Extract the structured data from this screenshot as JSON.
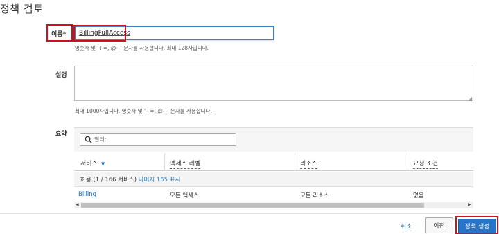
{
  "page": {
    "title": "정책 검토"
  },
  "name_field": {
    "label": "이름*",
    "value": "BillingFullAccess",
    "help": "영숫자 및 '+=,.@-_' 문자를 사용합니다. 최대 128자입니다."
  },
  "description_field": {
    "label": "설명",
    "help": "최대 1000자입니다. 영숫자 및 '+=,.@-_' 문자를 사용합니다."
  },
  "summary": {
    "label": "요약",
    "filter_placeholder": "필터:",
    "columns": [
      "서비스",
      "액세스 레벨",
      "리소스",
      "요청 조건"
    ],
    "group": {
      "prefix": "허용 (1 / 166 서비스) ",
      "link": "나머지 165 표시"
    },
    "rows": [
      {
        "service": "Billing",
        "access": "모든 액세스",
        "resource": "모든 리소스",
        "condition": "없음"
      }
    ]
  },
  "footer": {
    "cancel": "취소",
    "previous": "이전",
    "create": "정책 생성"
  },
  "colors": {
    "accent": "#1a6fbf",
    "highlight": "#d0111b",
    "primary_button": "#2775c9"
  }
}
